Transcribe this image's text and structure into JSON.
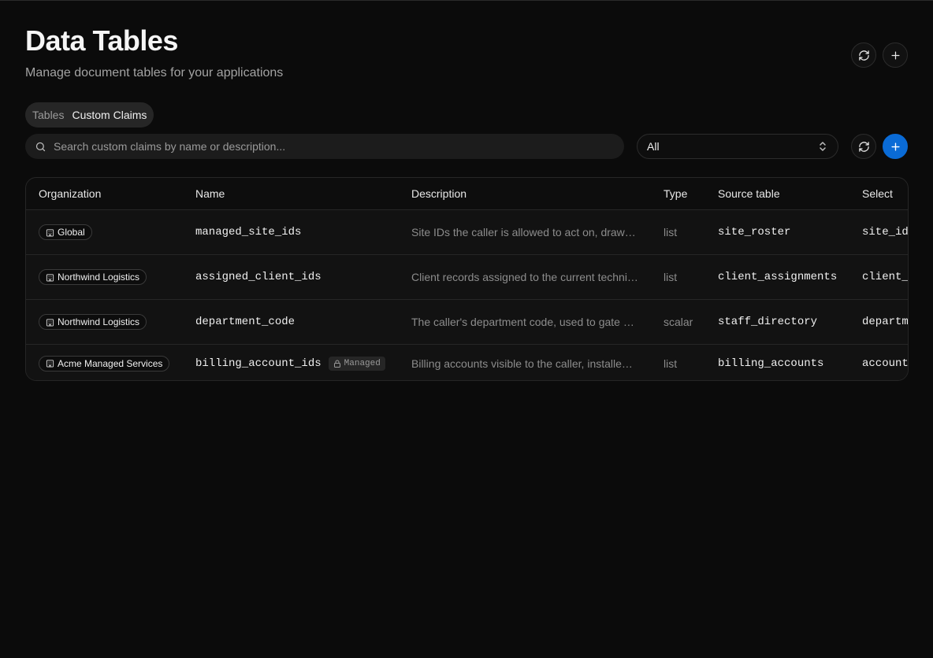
{
  "header": {
    "title": "Data Tables",
    "subtitle": "Manage document tables for your applications"
  },
  "tabs": [
    {
      "label": "Tables",
      "active": false
    },
    {
      "label": "Custom Claims",
      "active": true
    }
  ],
  "search": {
    "placeholder": "Search custom claims by name or description..."
  },
  "filter": {
    "selected": "All"
  },
  "table": {
    "columns": [
      "Organization",
      "Name",
      "Description",
      "Type",
      "Source table",
      "Select"
    ],
    "rows": [
      {
        "organization": "Global",
        "name": "managed_site_ids",
        "managed": false,
        "description": "Site IDs the caller is allowed to act on, draw…",
        "type": "list",
        "source_table": "site_roster",
        "select": "site_id"
      },
      {
        "organization": "Northwind Logistics",
        "name": "assigned_client_ids",
        "managed": false,
        "description": "Client records assigned to the current techni…",
        "type": "list",
        "source_table": "client_assignments",
        "select": "client_"
      },
      {
        "organization": "Northwind Logistics",
        "name": "department_code",
        "managed": false,
        "description": "The caller's department code, used to gate …",
        "type": "scalar",
        "source_table": "staff_directory",
        "select": "departm"
      },
      {
        "organization": "Acme Managed Services",
        "name": "billing_account_ids",
        "managed": true,
        "managed_label": "Managed",
        "description": "Billing accounts visible to the caller, installe…",
        "type": "list",
        "source_table": "billing_accounts",
        "select": "account"
      }
    ]
  },
  "icons": {
    "refresh": "refresh-icon",
    "add": "plus-icon",
    "search": "search-icon",
    "org": "building-icon",
    "lock": "lock-icon",
    "select": "chevron-up-down-icon"
  },
  "colors": {
    "background": "#0b0b0b",
    "accent": "#0a6bd6",
    "row_background": "#121212"
  }
}
